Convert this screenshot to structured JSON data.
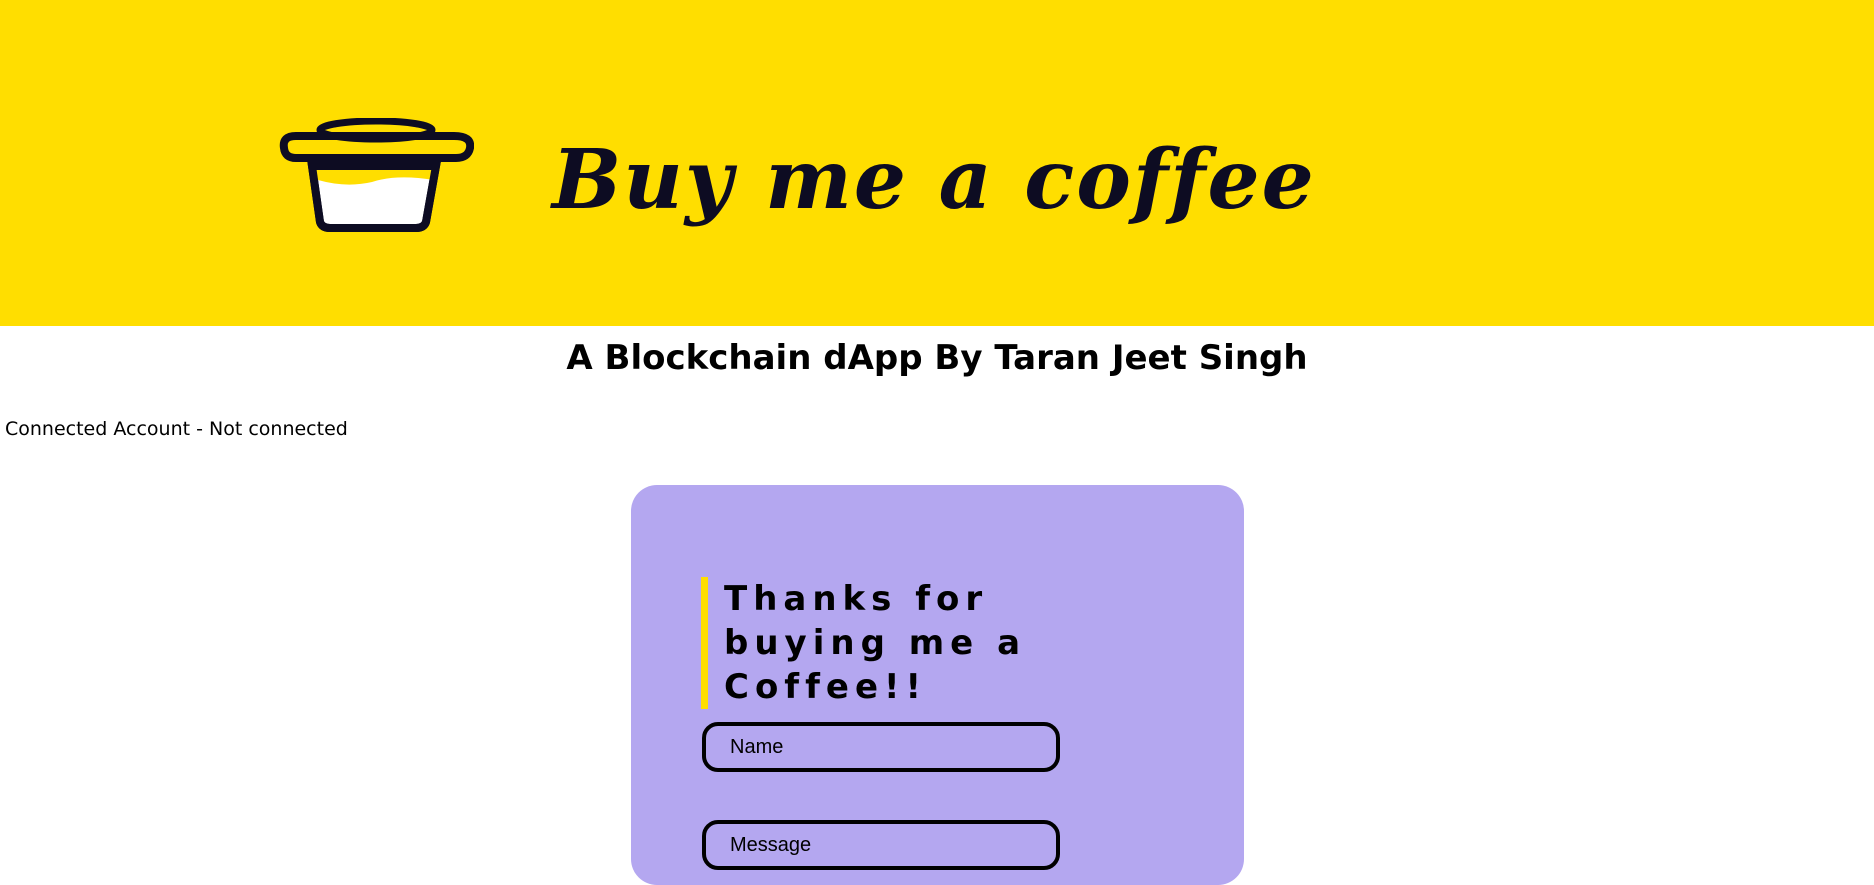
{
  "banner": {
    "brand_text": "Buy me a coffee",
    "logo_icon": "coffee-cup-icon",
    "background_color": "#ffde00"
  },
  "header": {
    "title": "A Blockchain dApp By Taran Jeet Singh"
  },
  "account": {
    "status_text": "Connected Account - Not connected"
  },
  "form": {
    "heading": "Thanks for buying me a Coffee!!",
    "name_placeholder": "Name",
    "message_placeholder": "Message",
    "background_color": "#b4a7f0",
    "accent_color": "#ffde00"
  }
}
